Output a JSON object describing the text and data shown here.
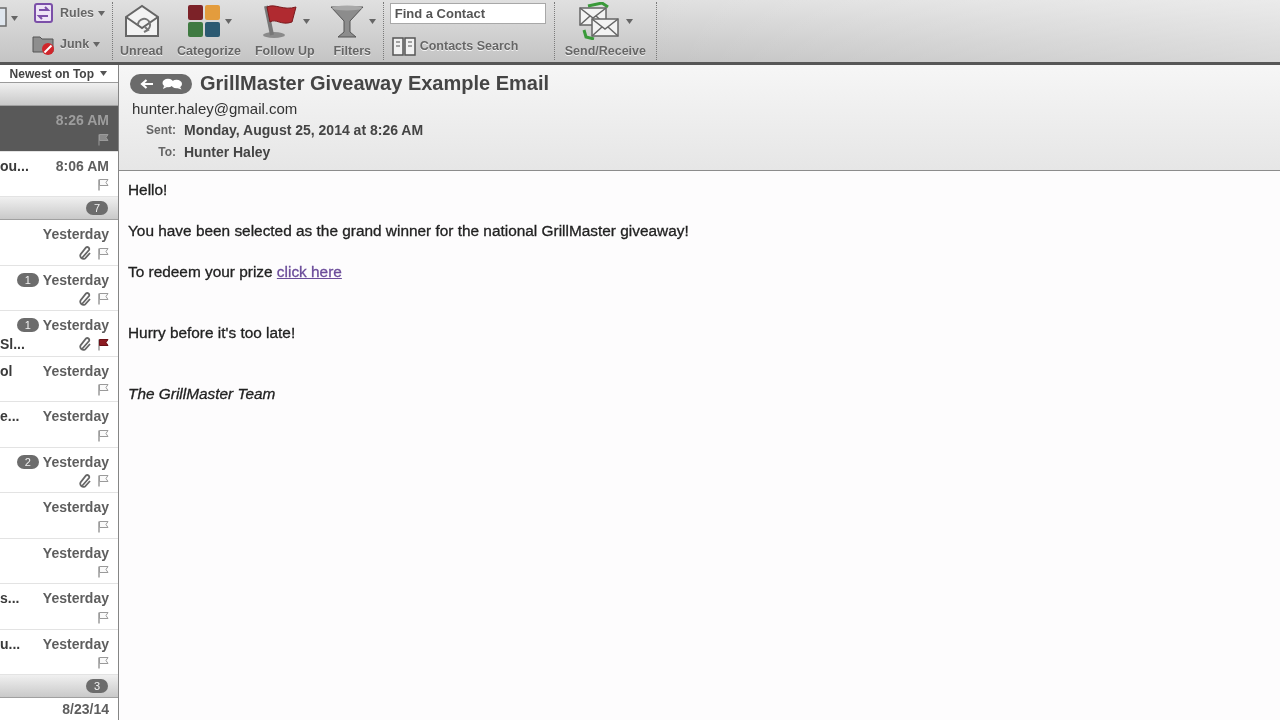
{
  "toolbar": {
    "edge_item": {
      "menu": true
    },
    "small_buttons": [
      {
        "label": "Rules",
        "menu": true
      },
      {
        "label": "Junk",
        "menu": true
      }
    ],
    "buttons": [
      {
        "label": "Unread",
        "menu": false
      },
      {
        "label": "Categorize",
        "menu": true
      },
      {
        "label": "Follow Up",
        "menu": true
      },
      {
        "label": "Filters",
        "menu": true
      }
    ],
    "contact_search": {
      "placeholder": "Find a Contact",
      "button": "Contacts Search"
    },
    "send_receive": {
      "label": "Send/Receive",
      "menu": true
    }
  },
  "message_list": {
    "sort": "Newest on Top",
    "items": [
      {
        "kind": "group"
      },
      {
        "kind": "message",
        "selected": true,
        "time": "8:26 AM",
        "flagged": false,
        "attachment": false
      },
      {
        "kind": "message",
        "selected": false,
        "sender": "ou...",
        "time": "8:06 AM",
        "flagged": false,
        "attachment": false
      },
      {
        "kind": "group",
        "count": "7"
      },
      {
        "kind": "message",
        "selected": false,
        "time": "Yesterday",
        "flagged": false,
        "attachment": true
      },
      {
        "kind": "message",
        "selected": false,
        "thread_count": "1",
        "time": "Yesterday",
        "flagged": false,
        "attachment": true
      },
      {
        "kind": "message",
        "selected": false,
        "thread_count": "1",
        "time": "Yesterday",
        "subject": "Sl...",
        "flagged": true,
        "attachment": true
      },
      {
        "kind": "message",
        "selected": false,
        "sender": "ol",
        "time": "Yesterday",
        "flagged": false,
        "attachment": false
      },
      {
        "kind": "message",
        "selected": false,
        "sender": "e...",
        "time": "Yesterday",
        "flagged": false,
        "attachment": false
      },
      {
        "kind": "message",
        "selected": false,
        "thread_count": "2",
        "time": "Yesterday",
        "flagged": false,
        "attachment": true
      },
      {
        "kind": "message",
        "selected": false,
        "time": "Yesterday",
        "flagged": false,
        "attachment": false
      },
      {
        "kind": "message",
        "selected": false,
        "time": "Yesterday",
        "flagged": false,
        "attachment": false
      },
      {
        "kind": "message",
        "selected": false,
        "sender": "s...",
        "time": "Yesterday",
        "flagged": false,
        "attachment": false
      },
      {
        "kind": "message",
        "selected": false,
        "sender": "u...",
        "time": "Yesterday",
        "flagged": false,
        "attachment": false
      },
      {
        "kind": "group",
        "count": "3"
      },
      {
        "kind": "message",
        "selected": false,
        "time": "8/23/14"
      }
    ]
  },
  "message": {
    "subject": "GrillMaster Giveaway Example Email",
    "from": "hunter.haley@gmail.com",
    "fields": [
      {
        "label": "Sent:",
        "value": "Monday, August 25, 2014 at 8:26 AM"
      },
      {
        "label": "To:",
        "value": "Hunter Haley"
      }
    ],
    "body": [
      {
        "kind": "text",
        "text": "Hello!"
      },
      {
        "kind": "text",
        "text": "You have been selected as the grand winner for the national GrillMaster giveaway!"
      },
      {
        "kind": "link_line",
        "text": "To redeem your prize",
        "link": "click here"
      },
      {
        "kind": "blank"
      },
      {
        "kind": "text",
        "text": "Hurry before it's too late!"
      },
      {
        "kind": "blank"
      },
      {
        "kind": "signature",
        "text": "The GrillMaster Team"
      }
    ]
  }
}
